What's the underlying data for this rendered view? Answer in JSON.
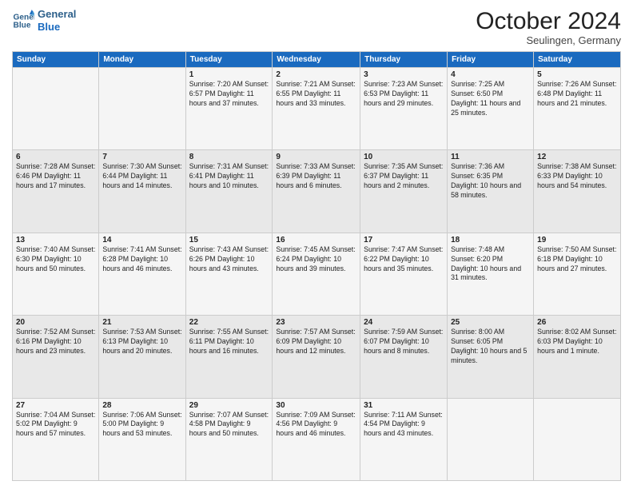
{
  "header": {
    "logo_line1": "General",
    "logo_line2": "Blue",
    "month": "October 2024",
    "location": "Seulingen, Germany"
  },
  "days_of_week": [
    "Sunday",
    "Monday",
    "Tuesday",
    "Wednesday",
    "Thursday",
    "Friday",
    "Saturday"
  ],
  "weeks": [
    [
      {
        "day": "",
        "detail": ""
      },
      {
        "day": "",
        "detail": ""
      },
      {
        "day": "1",
        "detail": "Sunrise: 7:20 AM\nSunset: 6:57 PM\nDaylight: 11 hours\nand 37 minutes."
      },
      {
        "day": "2",
        "detail": "Sunrise: 7:21 AM\nSunset: 6:55 PM\nDaylight: 11 hours\nand 33 minutes."
      },
      {
        "day": "3",
        "detail": "Sunrise: 7:23 AM\nSunset: 6:53 PM\nDaylight: 11 hours\nand 29 minutes."
      },
      {
        "day": "4",
        "detail": "Sunrise: 7:25 AM\nSunset: 6:50 PM\nDaylight: 11 hours\nand 25 minutes."
      },
      {
        "day": "5",
        "detail": "Sunrise: 7:26 AM\nSunset: 6:48 PM\nDaylight: 11 hours\nand 21 minutes."
      }
    ],
    [
      {
        "day": "6",
        "detail": "Sunrise: 7:28 AM\nSunset: 6:46 PM\nDaylight: 11 hours\nand 17 minutes."
      },
      {
        "day": "7",
        "detail": "Sunrise: 7:30 AM\nSunset: 6:44 PM\nDaylight: 11 hours\nand 14 minutes."
      },
      {
        "day": "8",
        "detail": "Sunrise: 7:31 AM\nSunset: 6:41 PM\nDaylight: 11 hours\nand 10 minutes."
      },
      {
        "day": "9",
        "detail": "Sunrise: 7:33 AM\nSunset: 6:39 PM\nDaylight: 11 hours\nand 6 minutes."
      },
      {
        "day": "10",
        "detail": "Sunrise: 7:35 AM\nSunset: 6:37 PM\nDaylight: 11 hours\nand 2 minutes."
      },
      {
        "day": "11",
        "detail": "Sunrise: 7:36 AM\nSunset: 6:35 PM\nDaylight: 10 hours\nand 58 minutes."
      },
      {
        "day": "12",
        "detail": "Sunrise: 7:38 AM\nSunset: 6:33 PM\nDaylight: 10 hours\nand 54 minutes."
      }
    ],
    [
      {
        "day": "13",
        "detail": "Sunrise: 7:40 AM\nSunset: 6:30 PM\nDaylight: 10 hours\nand 50 minutes."
      },
      {
        "day": "14",
        "detail": "Sunrise: 7:41 AM\nSunset: 6:28 PM\nDaylight: 10 hours\nand 46 minutes."
      },
      {
        "day": "15",
        "detail": "Sunrise: 7:43 AM\nSunset: 6:26 PM\nDaylight: 10 hours\nand 43 minutes."
      },
      {
        "day": "16",
        "detail": "Sunrise: 7:45 AM\nSunset: 6:24 PM\nDaylight: 10 hours\nand 39 minutes."
      },
      {
        "day": "17",
        "detail": "Sunrise: 7:47 AM\nSunset: 6:22 PM\nDaylight: 10 hours\nand 35 minutes."
      },
      {
        "day": "18",
        "detail": "Sunrise: 7:48 AM\nSunset: 6:20 PM\nDaylight: 10 hours\nand 31 minutes."
      },
      {
        "day": "19",
        "detail": "Sunrise: 7:50 AM\nSunset: 6:18 PM\nDaylight: 10 hours\nand 27 minutes."
      }
    ],
    [
      {
        "day": "20",
        "detail": "Sunrise: 7:52 AM\nSunset: 6:16 PM\nDaylight: 10 hours\nand 23 minutes."
      },
      {
        "day": "21",
        "detail": "Sunrise: 7:53 AM\nSunset: 6:13 PM\nDaylight: 10 hours\nand 20 minutes."
      },
      {
        "day": "22",
        "detail": "Sunrise: 7:55 AM\nSunset: 6:11 PM\nDaylight: 10 hours\nand 16 minutes."
      },
      {
        "day": "23",
        "detail": "Sunrise: 7:57 AM\nSunset: 6:09 PM\nDaylight: 10 hours\nand 12 minutes."
      },
      {
        "day": "24",
        "detail": "Sunrise: 7:59 AM\nSunset: 6:07 PM\nDaylight: 10 hours\nand 8 minutes."
      },
      {
        "day": "25",
        "detail": "Sunrise: 8:00 AM\nSunset: 6:05 PM\nDaylight: 10 hours\nand 5 minutes."
      },
      {
        "day": "26",
        "detail": "Sunrise: 8:02 AM\nSunset: 6:03 PM\nDaylight: 10 hours\nand 1 minute."
      }
    ],
    [
      {
        "day": "27",
        "detail": "Sunrise: 7:04 AM\nSunset: 5:02 PM\nDaylight: 9 hours\nand 57 minutes."
      },
      {
        "day": "28",
        "detail": "Sunrise: 7:06 AM\nSunset: 5:00 PM\nDaylight: 9 hours\nand 53 minutes."
      },
      {
        "day": "29",
        "detail": "Sunrise: 7:07 AM\nSunset: 4:58 PM\nDaylight: 9 hours\nand 50 minutes."
      },
      {
        "day": "30",
        "detail": "Sunrise: 7:09 AM\nSunset: 4:56 PM\nDaylight: 9 hours\nand 46 minutes."
      },
      {
        "day": "31",
        "detail": "Sunrise: 7:11 AM\nSunset: 4:54 PM\nDaylight: 9 hours\nand 43 minutes."
      },
      {
        "day": "",
        "detail": ""
      },
      {
        "day": "",
        "detail": ""
      }
    ]
  ]
}
